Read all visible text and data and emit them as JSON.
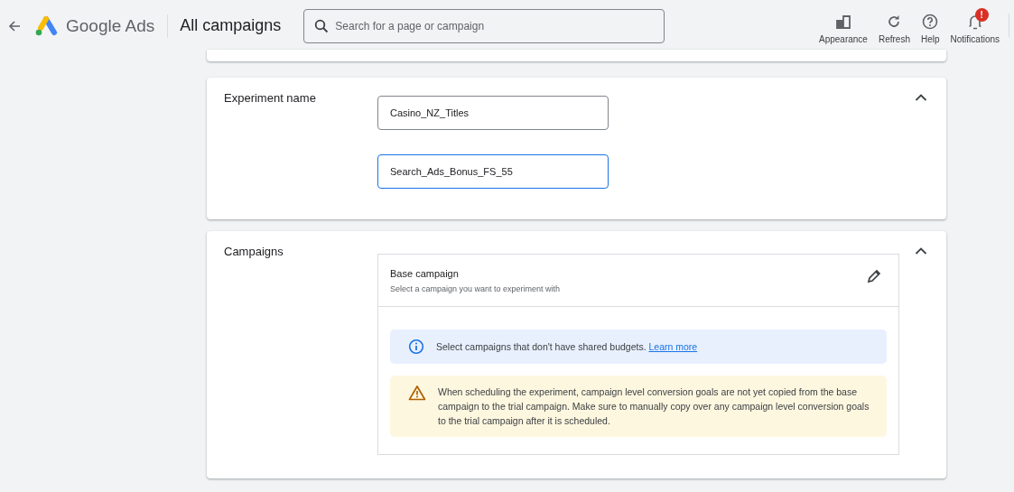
{
  "header": {
    "product": "Google Ads",
    "page_title": "All campaigns",
    "search": {
      "placeholder": "Search for a page or campaign"
    },
    "actions": [
      {
        "kind": "appearance",
        "label": "Appearance"
      },
      {
        "kind": "refresh",
        "label": "Refresh"
      },
      {
        "kind": "help",
        "label": "Help"
      },
      {
        "kind": "notifications",
        "label": "Notifications",
        "badge": "!"
      }
    ]
  },
  "sections": [
    {
      "kind": "name",
      "title": "Experiment name",
      "expanded": true,
      "fields": [
        {
          "value": "Casino_NZ_Titles",
          "focused": false
        },
        {
          "value": "Search_Ads_Bonus_FS_55",
          "focused": true
        }
      ]
    },
    {
      "kind": "campaigns",
      "title": "Campaigns",
      "expanded": true,
      "base": {
        "title": "Base campaign",
        "subtitle": "Select a campaign you want to experiment with"
      },
      "notices": [
        {
          "kind": "info",
          "text": "Select campaigns that don't have shared budgets.",
          "link": "Learn more"
        },
        {
          "kind": "warning",
          "text": "When scheduling the experiment, campaign level conversion goals are not yet copied from the base campaign to the trial campaign. Make sure to manually copy over any campaign level conversion goals to the trial campaign after it is scheduled."
        }
      ]
    }
  ]
}
